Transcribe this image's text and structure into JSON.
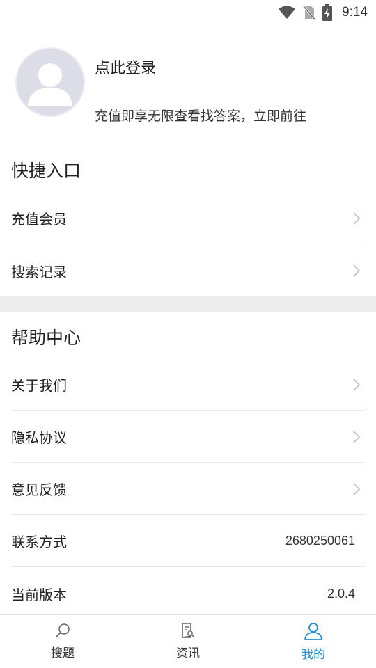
{
  "status_bar": {
    "time": "9:14",
    "icons": [
      "wifi-icon",
      "no-sim-icon",
      "battery-charging-icon"
    ]
  },
  "profile": {
    "avatar_icon": "default-avatar-icon",
    "login_text": "点此登录",
    "subtitle": "充值即享无限查看找答案，立即前往"
  },
  "quick_entry": {
    "title": "快捷入口",
    "items": [
      {
        "label": "充值会员"
      },
      {
        "label": "搜索记录"
      }
    ]
  },
  "help_center": {
    "title": "帮助中心",
    "items": [
      {
        "label": "关于我们"
      },
      {
        "label": "隐私协议"
      },
      {
        "label": "意见反馈"
      },
      {
        "label": "联系方式",
        "value": "2680250061"
      },
      {
        "label": "当前版本",
        "value": "2.0.4"
      }
    ]
  },
  "tab_bar": {
    "tabs": [
      {
        "label": "搜题",
        "icon": "search-icon",
        "active": false
      },
      {
        "label": "资讯",
        "icon": "news-icon",
        "active": false
      },
      {
        "label": "我的",
        "icon": "profile-icon",
        "active": true
      }
    ]
  },
  "colors": {
    "accent": "#1f8dd6",
    "avatar_bg": "#dcdde7",
    "separator": "#ececec"
  }
}
